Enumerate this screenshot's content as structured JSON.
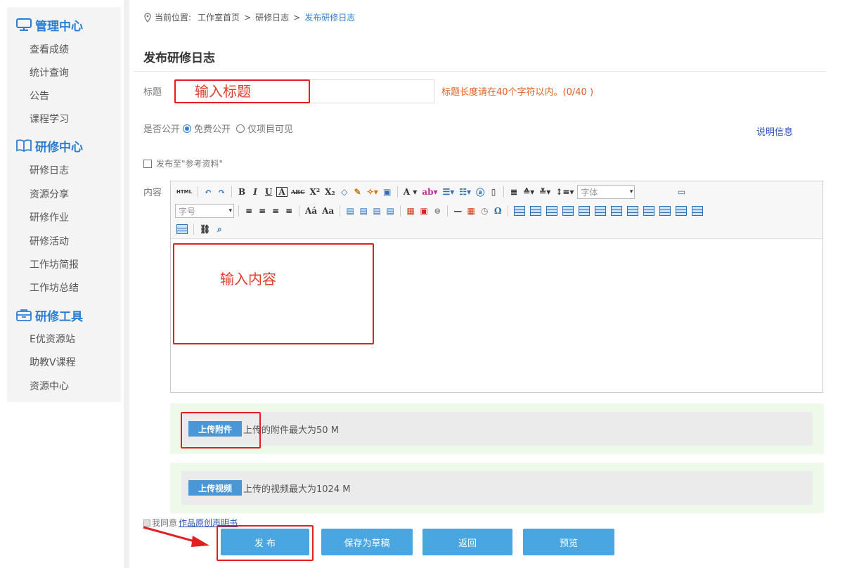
{
  "sidebar": {
    "sections": [
      {
        "title": "管理中心",
        "icon": "monitor-icon",
        "items": [
          "查看成绩",
          "统计查询",
          "公告",
          "课程学习"
        ]
      },
      {
        "title": "研修中心",
        "icon": "book-icon",
        "items": [
          "研修日志",
          "资源分享",
          "研修作业",
          "研修活动",
          "工作坊简报",
          "工作坊总结"
        ]
      },
      {
        "title": "研修工具",
        "icon": "toolbox-icon",
        "items": [
          "E优资源站",
          "助教V课程",
          "资源中心"
        ]
      }
    ]
  },
  "breadcrumb": {
    "prefix": "当前位置:",
    "crumbs": [
      "工作室首页",
      ">",
      "研修日志",
      ">",
      "发布研修日志"
    ]
  },
  "page_title": "发布研修日志",
  "form": {
    "title_label": "标题",
    "title_placeholder": "输入标题",
    "title_hint": "标题长度请在40个字符以内。(0/40  )",
    "public_label": "是否公开",
    "radio_options": [
      "免费公开",
      "仅项目可见"
    ],
    "explain_link": "说明信息",
    "publish_ref_label": "发布至\"参考资料\"",
    "content_label": "内容",
    "content_placeholder": "输入内容"
  },
  "editor": {
    "font_family_placeholder": "字体",
    "font_size_placeholder": "字号",
    "html_label": "HTML"
  },
  "uploads": {
    "attachment_button": "上传附件",
    "attachment_text": "上传的附件最大为50 M",
    "video_button": "上传视频",
    "video_text": "上传的视频最大为1024 M"
  },
  "agreement": {
    "prefix": "我同意",
    "link": "作品原创声明书"
  },
  "actions": {
    "publish": "发 布",
    "save_draft": "保存为草稿",
    "back": "返回",
    "preview": "预览"
  },
  "colors": {
    "accent": "#2a7fd4",
    "button": "#4aa6e0",
    "highlight_red": "#e02020",
    "hint_orange": "#e06020"
  }
}
